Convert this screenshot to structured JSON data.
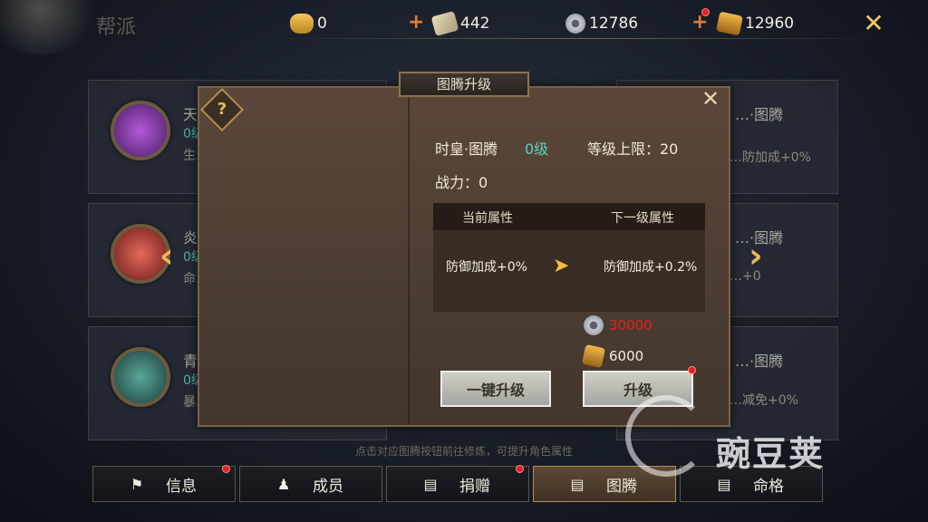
{
  "page_title": "帮派",
  "currencies": [
    {
      "name": "gold-ingot-icon",
      "value": "0"
    },
    {
      "name": "scroll-icon",
      "value": "442"
    },
    {
      "name": "coin-icon",
      "value": "12786"
    },
    {
      "name": "token-icon",
      "value": "12960"
    }
  ],
  "background_cards": [
    {
      "name": "天…·图腾",
      "level": "0级",
      "attr": "生…加成+0%"
    },
    {
      "name": "炎…·图腾",
      "level": "0级",
      "attr": "命…+0"
    },
    {
      "name": "青…·图腾",
      "level": "0级",
      "attr": "暴…+0"
    },
    {
      "name": "…·图腾",
      "attr": "…防加成+0%"
    },
    {
      "name": "…·图腾",
      "attr": "…+0"
    },
    {
      "name": "…·图腾",
      "attr": "…减免+0%"
    }
  ],
  "dialog": {
    "title": "图腾升级",
    "help": "?",
    "totem_name": "时皇·图腾",
    "level": "0级",
    "level_cap": "等级上限：20",
    "power": "战力：0",
    "attr_header_current": "当前属性",
    "attr_header_next": "下一级属性",
    "attr_current": "防御加成+0%",
    "attr_next": "防御加成+0.2%",
    "cost_coin": "30000",
    "cost_token": "6000",
    "btn_one_key": "一键升级",
    "btn_upgrade": "升级"
  },
  "hint": "点击对应图腾按钮前往修炼，可提升角色属性",
  "tabs": [
    {
      "label": "信息",
      "icon": "flag-icon",
      "dot": true
    },
    {
      "label": "成员",
      "icon": "member-icon",
      "dot": false
    },
    {
      "label": "捐赠",
      "icon": "donate-icon",
      "dot": true
    },
    {
      "label": "图腾",
      "icon": "totem-icon",
      "dot": false,
      "active": true
    },
    {
      "label": "命格",
      "icon": "fate-icon",
      "dot": false
    }
  ],
  "watermark": "豌豆荚",
  "colors": {
    "accent_gold": "#e8b955",
    "level_teal": "#5bd0be",
    "cost_red": "#e42020"
  }
}
